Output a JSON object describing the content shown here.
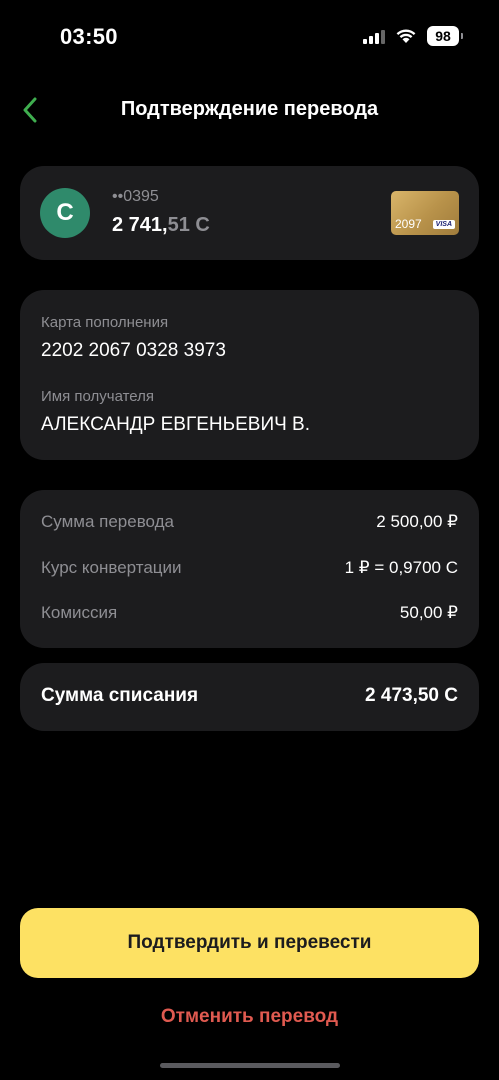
{
  "status_bar": {
    "time": "03:50",
    "battery": "98"
  },
  "header": {
    "title": "Подтверждение перевода",
    "back_icon": "chevron-left-icon",
    "accent_color": "#3fae4f"
  },
  "account": {
    "avatar_letter": "С",
    "avatar_color": "#2f8a6b",
    "number": "••0395",
    "balance_main": "2 741,",
    "balance_fraction": "51 С",
    "card_digits": "2097",
    "card_brand": "VISA"
  },
  "recipient": {
    "card_label": "Карта пополнения",
    "card_number": "2202 2067 0328 3973",
    "name_label": "Имя получателя",
    "name": "АЛЕКСАНДР ЕВГЕНЬЕВИЧ В."
  },
  "details": {
    "rows": [
      {
        "label": "Сумма перевода",
        "value": "2 500,00 ₽"
      },
      {
        "label": "Курс конвертации",
        "value": "1 ₽ = 0,9700 С"
      },
      {
        "label": "Комиссия",
        "value": "50,00 ₽"
      }
    ]
  },
  "total": {
    "label": "Сумма списания",
    "value": "2 473,50 С"
  },
  "actions": {
    "confirm_label": "Подтвердить и перевести",
    "confirm_color": "#fde163",
    "cancel_label": "Отменить перевод",
    "cancel_color": "#e05a50"
  }
}
